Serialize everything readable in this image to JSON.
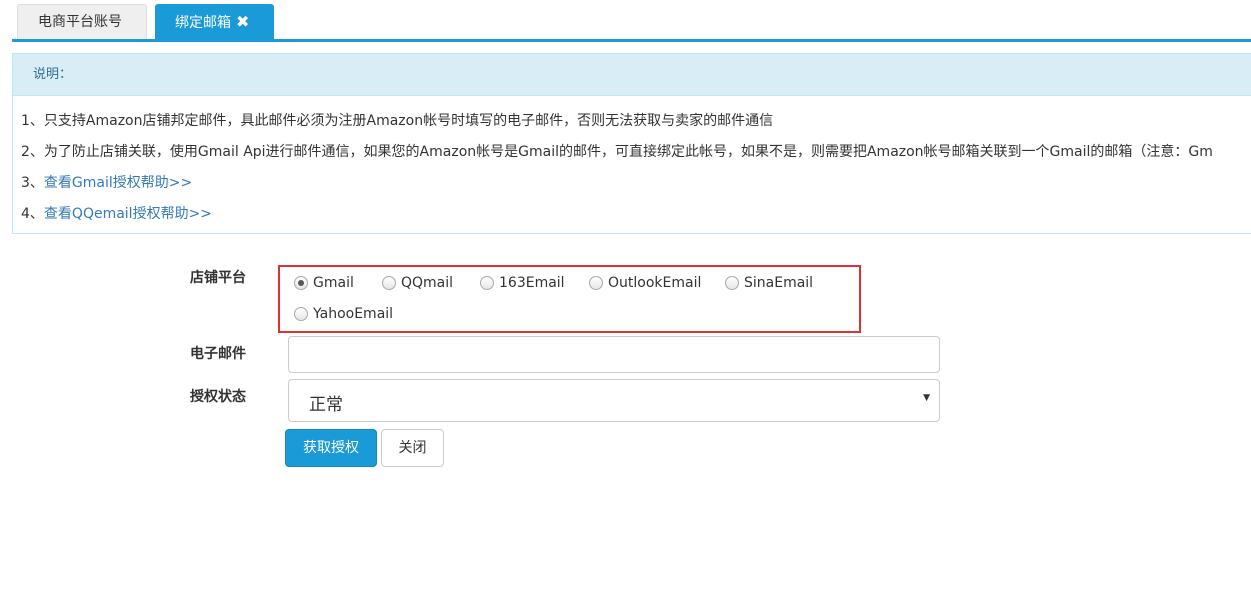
{
  "tabs": [
    {
      "label": "电商平台账号",
      "active": false
    },
    {
      "label": "绑定邮箱",
      "active": true,
      "close": "✖"
    }
  ],
  "info": {
    "title": "说明：",
    "lines": [
      "1、只支持Amazon店铺邦定邮件，具此邮件必须为注册Amazon帐号时填写的电子邮件，否则无法获取与卖家的邮件通信",
      "2、为了防止店铺关联，使用Gmail Api进行邮件通信，如果您的Amazon帐号是Gmail的邮件，可直接绑定此帐号，如果不是，则需要把Amazon帐号邮箱关联到一个Gmail的邮箱（注意：Gm"
    ],
    "links": [
      {
        "prefix": "3、",
        "text": "查看Gmail授权帮助>>"
      },
      {
        "prefix": "4、",
        "text": "查看QQemail授权帮助>>"
      }
    ]
  },
  "form": {
    "platform_label": "店铺平台",
    "platform_options": [
      "Gmail",
      "QQmail",
      "163Email",
      "OutlookEmail",
      "SinaEmail",
      "YahooEmail"
    ],
    "platform_selected": "Gmail",
    "email_label": "电子邮件",
    "email_value": "",
    "auth_label": "授权状态",
    "auth_value": "正常"
  },
  "buttons": {
    "authorize": "获取授权",
    "close": "关闭"
  },
  "colors": {
    "accent": "#1a9ad6",
    "highlight_border": "#e0312f",
    "info_bg": "#d9edf7",
    "link": "#337ab7"
  }
}
